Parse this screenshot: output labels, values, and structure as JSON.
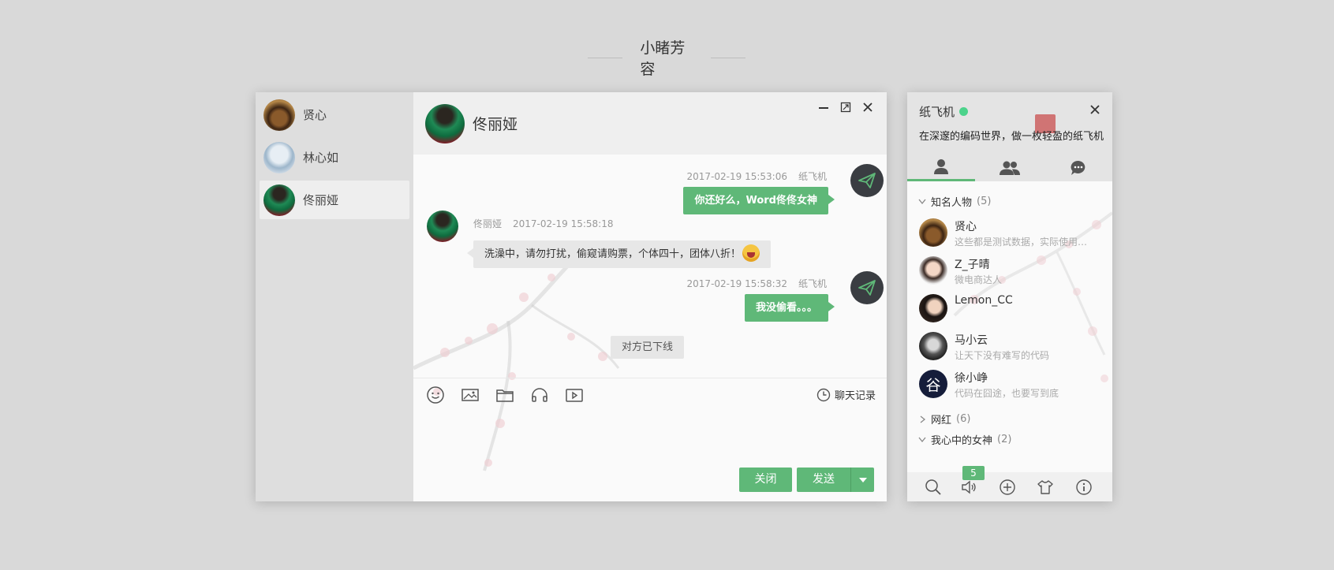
{
  "page": {
    "title": "小睹芳容"
  },
  "sessions": [
    {
      "name": "贤心",
      "avatar": "xianxin"
    },
    {
      "name": "林心如",
      "avatar": "linxinru"
    },
    {
      "name": "佟丽娅",
      "avatar": "tonglia",
      "active": true
    }
  ],
  "chat": {
    "title": "佟丽娅",
    "messages": [
      {
        "sender": "纸飞机",
        "time": "2017-02-19 15:53:06",
        "text": "你还好么，Word佟佟女神",
        "mine": true
      },
      {
        "sender": "佟丽娅",
        "time": "2017-02-19 15:58:18",
        "text": "洗澡中，请勿打扰，偷窥请购票，个体四十，团体八折！",
        "mine": false,
        "emoji": "laughing"
      },
      {
        "sender": "纸飞机",
        "time": "2017-02-19 15:58:32",
        "text": "我没偷看。。。",
        "mine": true
      }
    ],
    "system_note": "对方已下线",
    "toolbar": {
      "icons": [
        "emoji-icon",
        "image-icon",
        "folder-icon",
        "headphones-icon",
        "video-icon"
      ],
      "history_label": "聊天记录"
    },
    "buttons": {
      "close": "关闭",
      "send": "发送"
    }
  },
  "contacts": {
    "user": "纸飞机",
    "status": "online",
    "sign": "在深邃的编码世界，做一枚轻盈的纸飞机",
    "tabs": [
      "friends-icon",
      "groups-icon",
      "history-icon"
    ],
    "groups": [
      {
        "name": "知名人物",
        "count": "(5)",
        "expanded": true,
        "members": [
          {
            "name": "贤心",
            "sign": "这些都是测试数据，实际使用请严格按照该格式返回",
            "avatar": "xianxin"
          },
          {
            "name": "Z_子晴",
            "sign": "微电商达人",
            "avatar": "zizi"
          },
          {
            "name": "Lemon_CC",
            "sign": "",
            "avatar": "lemon"
          },
          {
            "name": "马小云",
            "sign": "让天下没有难写的代码",
            "avatar": "ma"
          },
          {
            "name": "徐小峥",
            "sign": "代码在囧途，也要写到底",
            "avatar": "xu",
            "avatar_char": "谷"
          }
        ]
      },
      {
        "name": "网红",
        "count": "(6)",
        "expanded": false
      },
      {
        "name": "我心中的女神",
        "count": "(2)",
        "expanded": true
      }
    ],
    "footer": {
      "icons": [
        "search-icon",
        "sound-icon",
        "add-icon",
        "skin-icon",
        "about-icon"
      ],
      "badge": "5"
    }
  },
  "colors": {
    "accent": "#5fb878",
    "online": "#4cd38b",
    "background": "#d9d9d9"
  }
}
